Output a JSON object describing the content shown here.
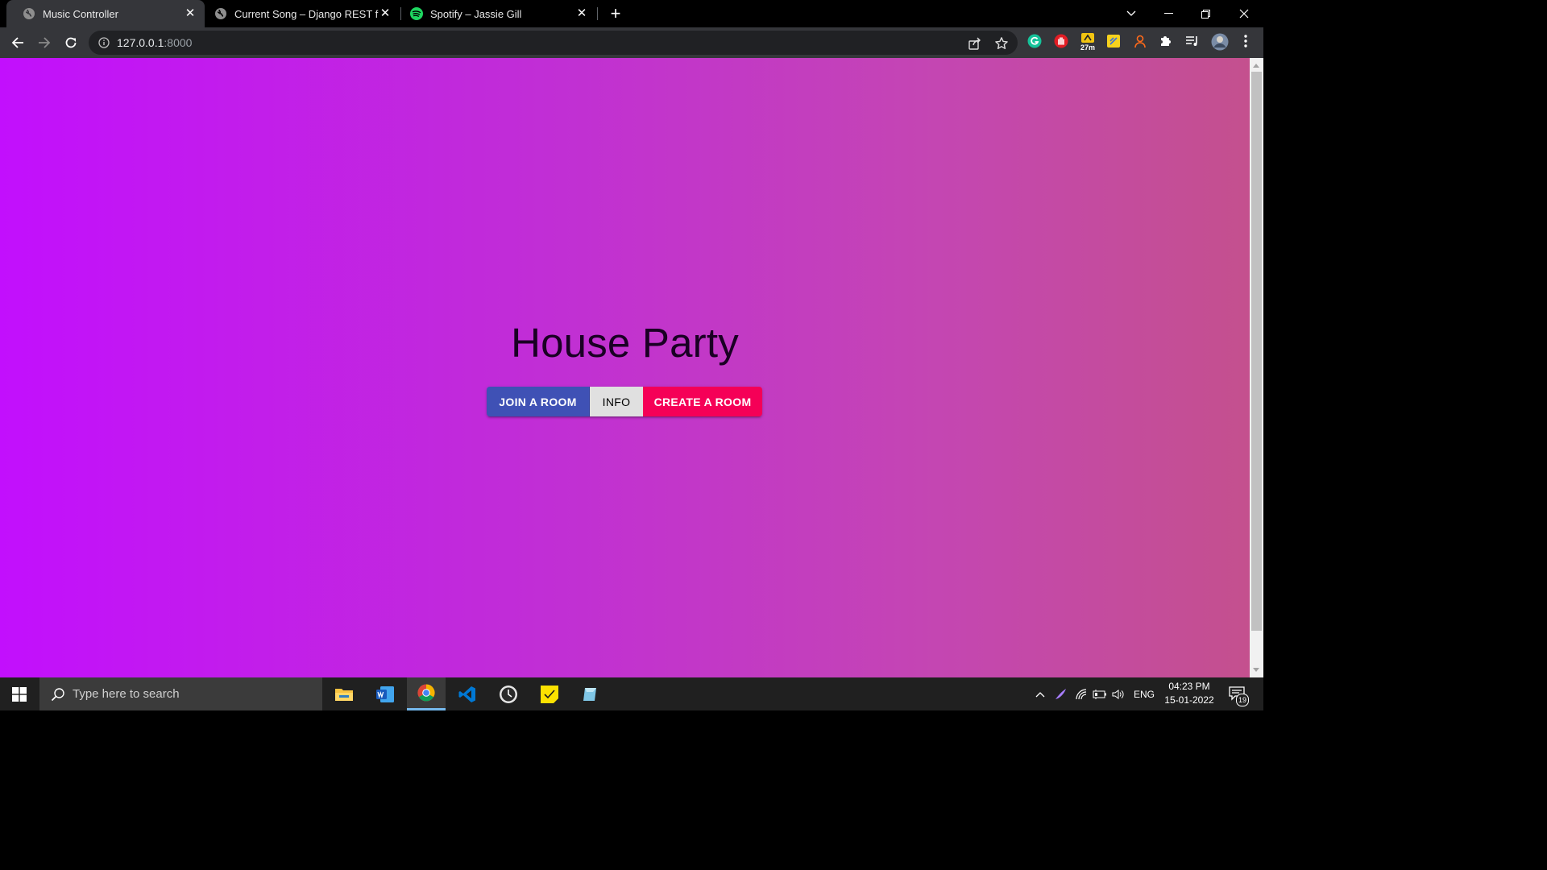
{
  "browser": {
    "tabs": [
      {
        "title": "Music Controller",
        "favicon": "globe-icon",
        "active": true
      },
      {
        "title": "Current Song – Django REST fram",
        "favicon": "globe-icon",
        "active": false
      },
      {
        "title": "Spotify – Jassie Gill",
        "favicon": "spotify-icon",
        "active": false
      }
    ],
    "url_host": "127.0.0.1",
    "url_port": ":8000",
    "extension_badge": "27m"
  },
  "page": {
    "heading": "House Party",
    "buttons": {
      "join": "JOIN A ROOM",
      "info": "INFO",
      "create": "CREATE A ROOM"
    }
  },
  "taskbar": {
    "search_placeholder": "Type here to search",
    "language": "ENG",
    "time": "04:23 PM",
    "date": "15-01-2022",
    "notification_count": "19"
  },
  "colors": {
    "join_button": "#3f51b5",
    "info_button": "#e0e0e0",
    "create_button": "#f50057",
    "gradient_start": "#c20ffd",
    "gradient_end": "#c4508e"
  }
}
